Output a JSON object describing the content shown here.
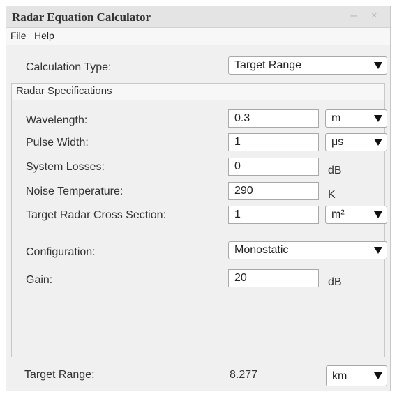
{
  "window": {
    "title": "Radar Equation Calculator",
    "controls": "– ×"
  },
  "menu": {
    "file": "File",
    "help": "Help"
  },
  "calc_type": {
    "label": "Calculation Type:",
    "value": "Target Range"
  },
  "panel": {
    "title": "Radar Specifications",
    "wavelength": {
      "label": "Wavelength:",
      "value": "0.3",
      "unit": "m"
    },
    "pulse_width": {
      "label": "Pulse Width:",
      "value": "1",
      "unit": "μs"
    },
    "system_losses": {
      "label": "System Losses:",
      "value": "0",
      "unit": "dB"
    },
    "noise_temp": {
      "label": "Noise Temperature:",
      "value": "290",
      "unit": "K"
    },
    "rcs": {
      "label": "Target Radar Cross Section:",
      "value": "1",
      "unit": "m²"
    },
    "configuration": {
      "label": "Configuration:",
      "value": "Monostatic"
    },
    "gain": {
      "label": "Gain:",
      "value": "20",
      "unit": "dB"
    }
  },
  "result": {
    "label": "Target Range:",
    "value": "8.277",
    "unit": "km"
  },
  "icons": {
    "dropdown": "chevron-down-icon"
  }
}
